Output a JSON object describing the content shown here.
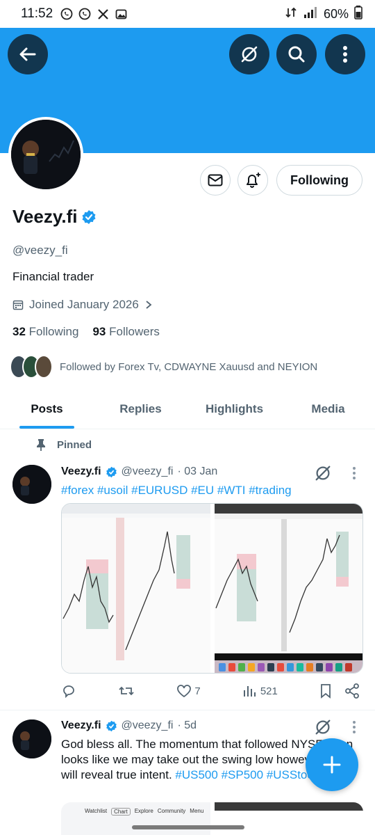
{
  "status": {
    "time": "11:52",
    "battery": "60%"
  },
  "colors": {
    "accent": "#1d9bf0",
    "text": "#0f1419",
    "muted": "#536471"
  },
  "profile": {
    "name": "Veezy.fi",
    "handle": "@veezy_fi",
    "bio": "Financial trader",
    "joined": "Joined January 2026",
    "following_count": "32",
    "following_label": "Following",
    "followers_count": "93",
    "followers_label": "Followers",
    "followed_by": "Followed by Forex Tv, CDWAYNE Xauusd and NEYION",
    "follow_button": "Following"
  },
  "tabs": [
    "Posts",
    "Replies",
    "Highlights",
    "Media"
  ],
  "pinned_label": "Pinned",
  "posts": [
    {
      "name": "Veezy.fi",
      "handle": "@veezy_fi",
      "time": "· 03 Jan",
      "text": "#forex #usoil #EURUSD #EU #WTI #trading",
      "likes": "7",
      "views": "521"
    },
    {
      "name": "Veezy.fi",
      "handle": "@veezy_fi",
      "time": "· 5d",
      "text_plain": "God bless all. The momentum that followed NYSE open looks like we may take out the swing low however close will reveal true intent. ",
      "text_tags": "#US500 #SP500 #USStocks"
    }
  ],
  "media_bottom": {
    "tabs": [
      "Watchlist",
      "Chart",
      "Explore",
      "Community",
      "Menu"
    ]
  }
}
